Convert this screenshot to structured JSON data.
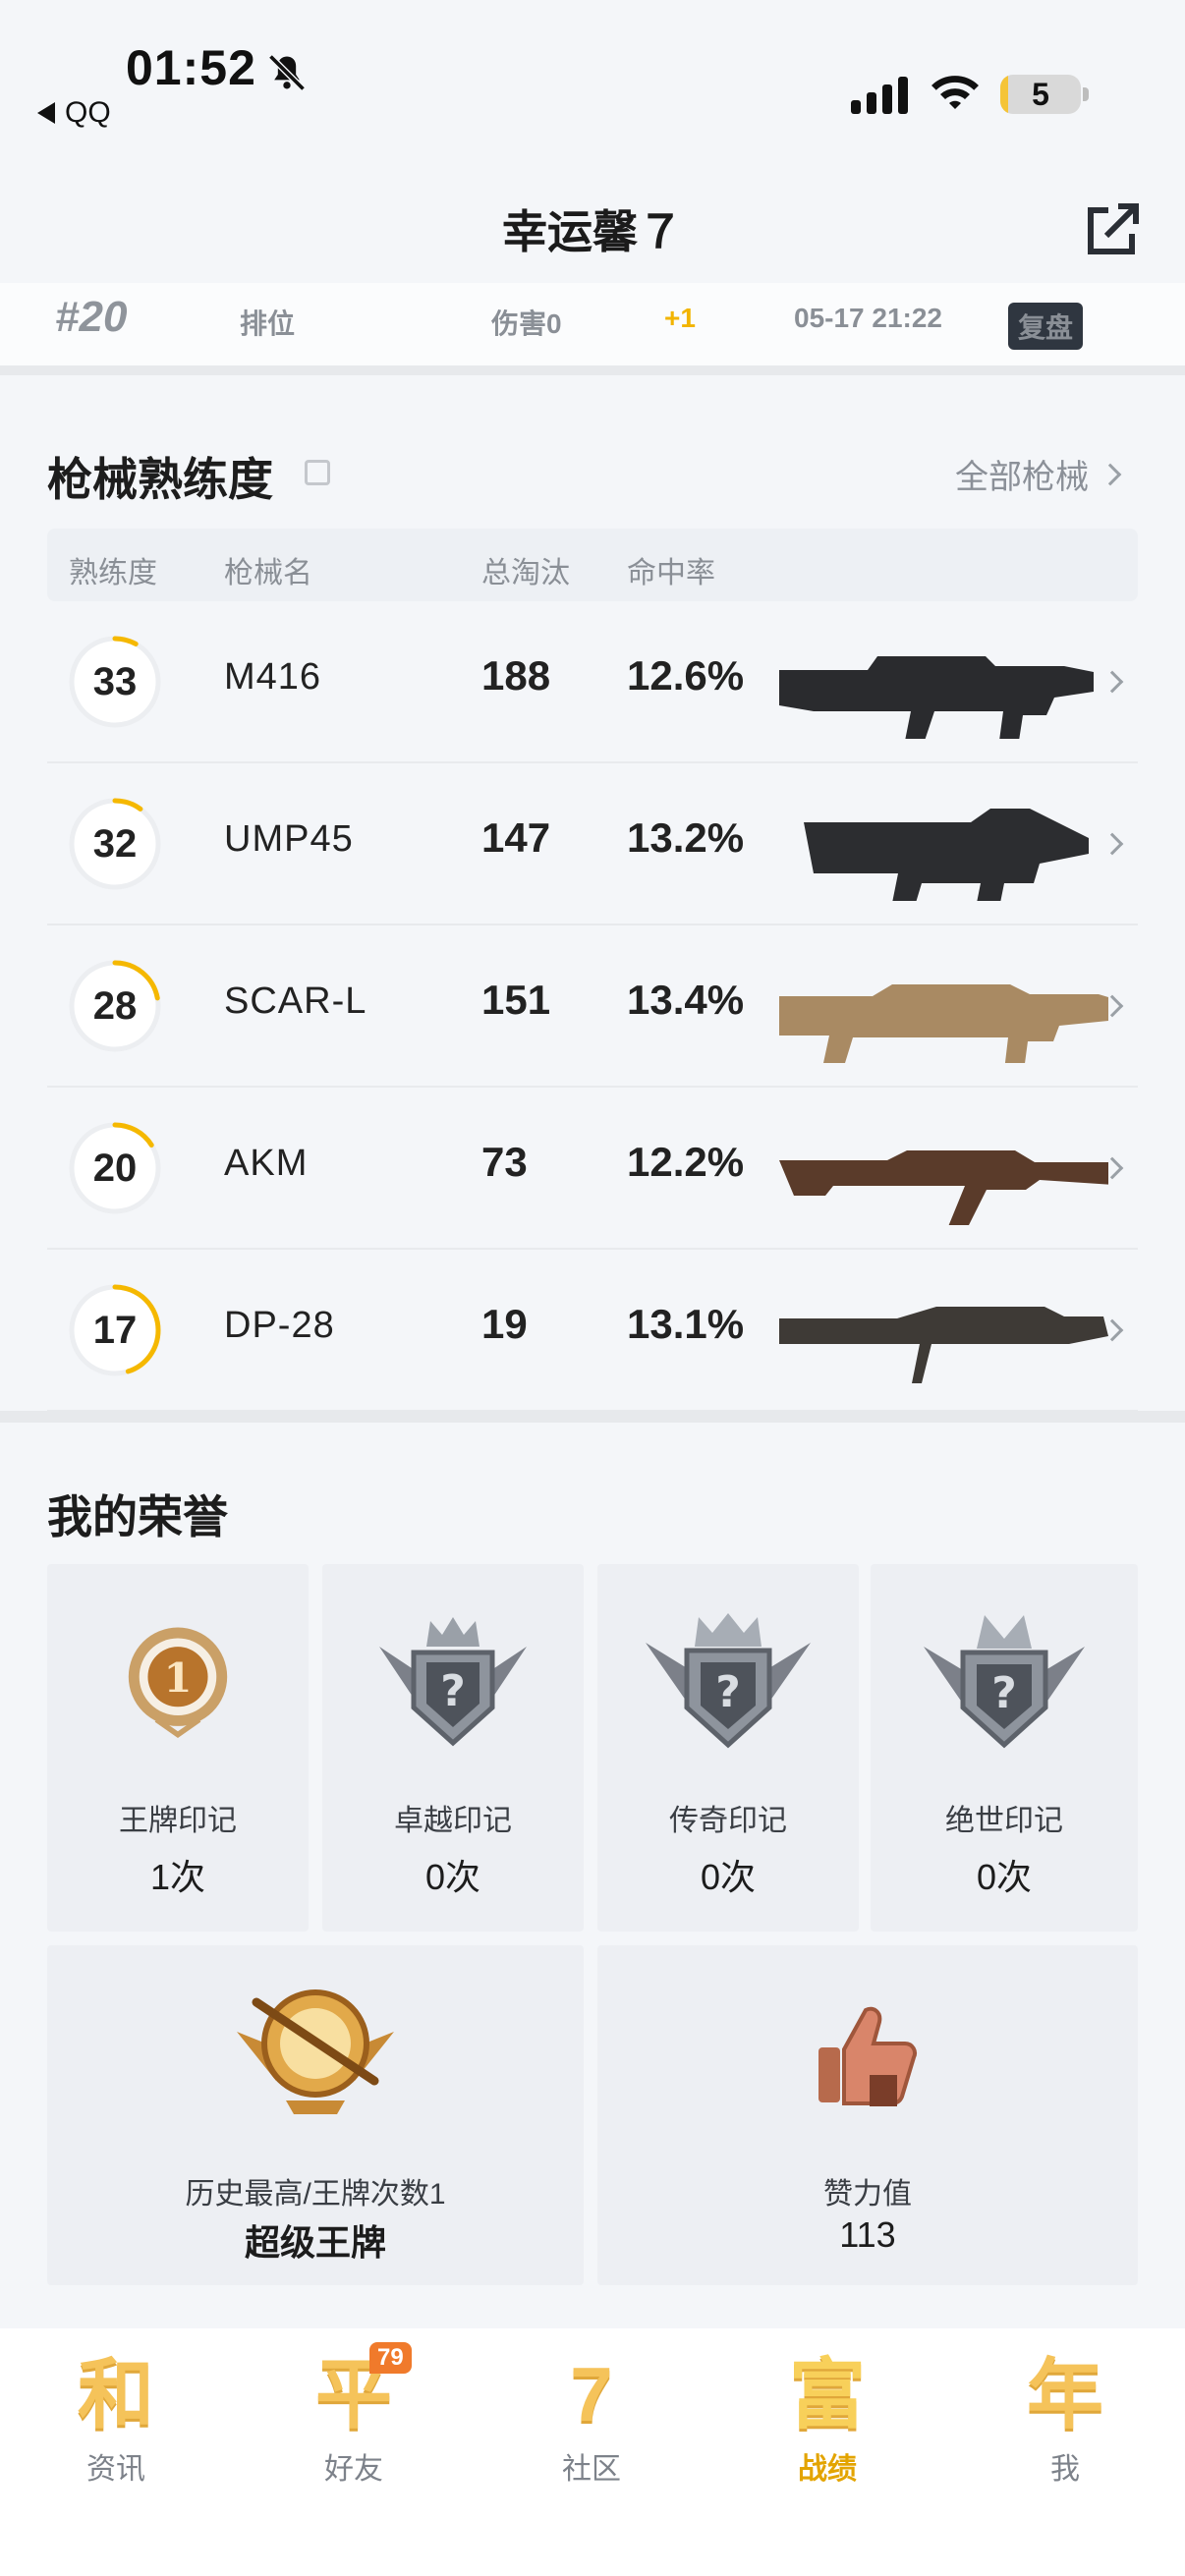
{
  "status_bar": {
    "time": "01:52",
    "back_app": "QQ",
    "battery": "5"
  },
  "header": {
    "title": "幸运馨７"
  },
  "match": {
    "rank": "#20",
    "mode": "排位",
    "damage": "伤害0",
    "points": "+1",
    "date": "05-17 21:22",
    "replay": "复盘"
  },
  "weapons": {
    "section_title": "枪械熟练度",
    "all_link": "全部枪械",
    "columns": [
      "熟练度",
      "枪械名",
      "总淘汰",
      "命中率"
    ],
    "rows": [
      {
        "level": "33",
        "name": "M416",
        "kills": "188",
        "accuracy": "12.6%",
        "progress": 0.08
      },
      {
        "level": "32",
        "name": "UMP45",
        "kills": "147",
        "accuracy": "13.2%",
        "progress": 0.1
      },
      {
        "level": "28",
        "name": "SCAR-L",
        "kills": "151",
        "accuracy": "13.4%",
        "progress": 0.22
      },
      {
        "level": "20",
        "name": "AKM",
        "kills": "73",
        "accuracy": "12.2%",
        "progress": 0.16
      },
      {
        "level": "17",
        "name": "DP-28",
        "kills": "19",
        "accuracy": "13.1%",
        "progress": 0.45
      }
    ]
  },
  "honors": {
    "section_title": "我的荣誉",
    "marks": [
      {
        "label": "王牌印记",
        "count": "1次"
      },
      {
        "label": "卓越印记",
        "count": "0次"
      },
      {
        "label": "传奇印记",
        "count": "0次"
      },
      {
        "label": "绝世印记",
        "count": "0次"
      }
    ],
    "highest": {
      "label": "历史最高/王牌次数1",
      "value": "超级王牌"
    },
    "likes": {
      "label": "赞力值",
      "value": "113"
    }
  },
  "nav": {
    "items": [
      {
        "glyph": "和",
        "label": "资讯"
      },
      {
        "glyph": "平",
        "label": "好友"
      },
      {
        "glyph": "7",
        "label": "社区"
      },
      {
        "glyph": "富",
        "label": "战绩"
      },
      {
        "glyph": "年",
        "label": "我"
      }
    ],
    "friends_badge": "79"
  },
  "colors": {
    "accent": "#f5b800",
    "ring_track": "#eceef1",
    "active_tab": "#e3a400"
  }
}
